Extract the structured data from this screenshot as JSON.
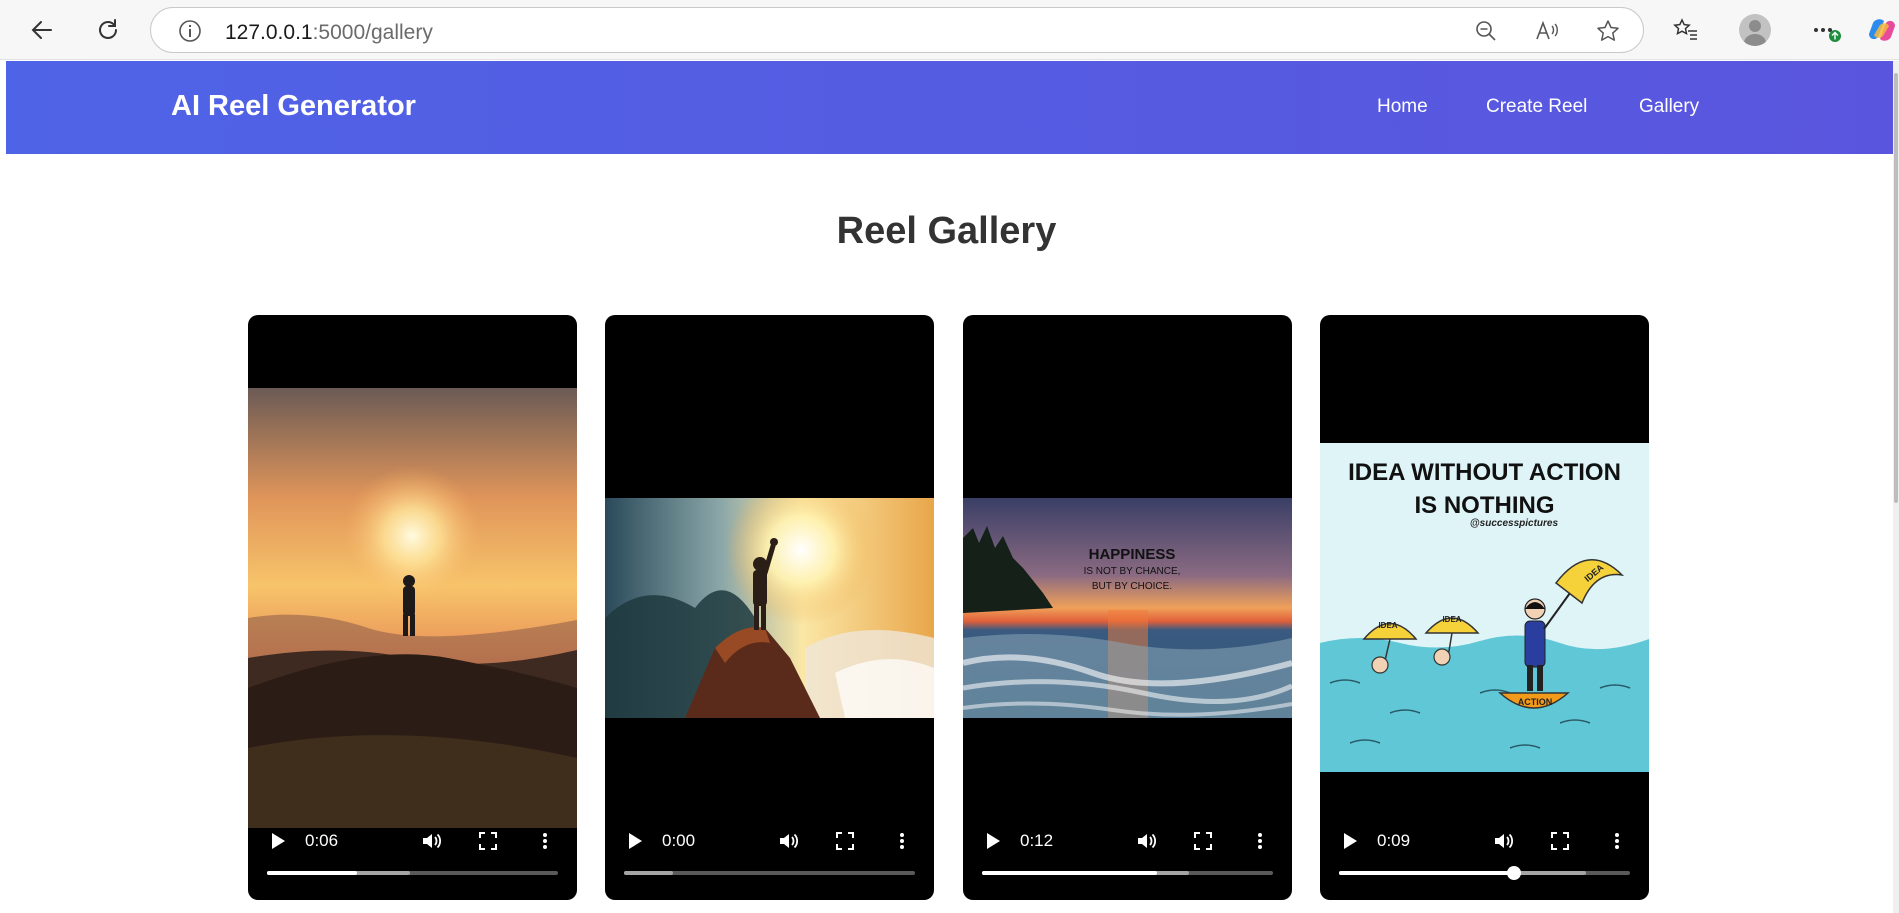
{
  "browser": {
    "url_host": "127.0.0.1",
    "url_path": ":5000/gallery"
  },
  "app": {
    "brand": "AI Reel Generator",
    "nav": [
      "Home",
      "Create Reel",
      "Gallery"
    ]
  },
  "page": {
    "title": "Reel Gallery"
  },
  "reels": [
    {
      "time": "0:06",
      "played_fraction": 0.31,
      "buffered_fraction": 0.49
    },
    {
      "time": "0:00",
      "played_fraction": 0.0,
      "buffered_fraction": 0.17
    },
    {
      "time": "0:12",
      "played_fraction": 0.6,
      "buffered_fraction": 0.71
    },
    {
      "time": "0:09",
      "played_fraction": 0.6,
      "buffered_fraction": 0.85,
      "show_knob": true
    }
  ],
  "posters": {
    "happiness_title": "HAPPINESS",
    "happiness_line1": "IS NOT BY CHANCE,",
    "happiness_line2": "BUT BY CHOICE.",
    "idea_line1": "IDEA WITHOUT ACTION",
    "idea_line2": "IS NOTHING",
    "idea_credit": "@successpictures",
    "umbrella_label": "IDEA",
    "boat_label": "ACTION"
  }
}
